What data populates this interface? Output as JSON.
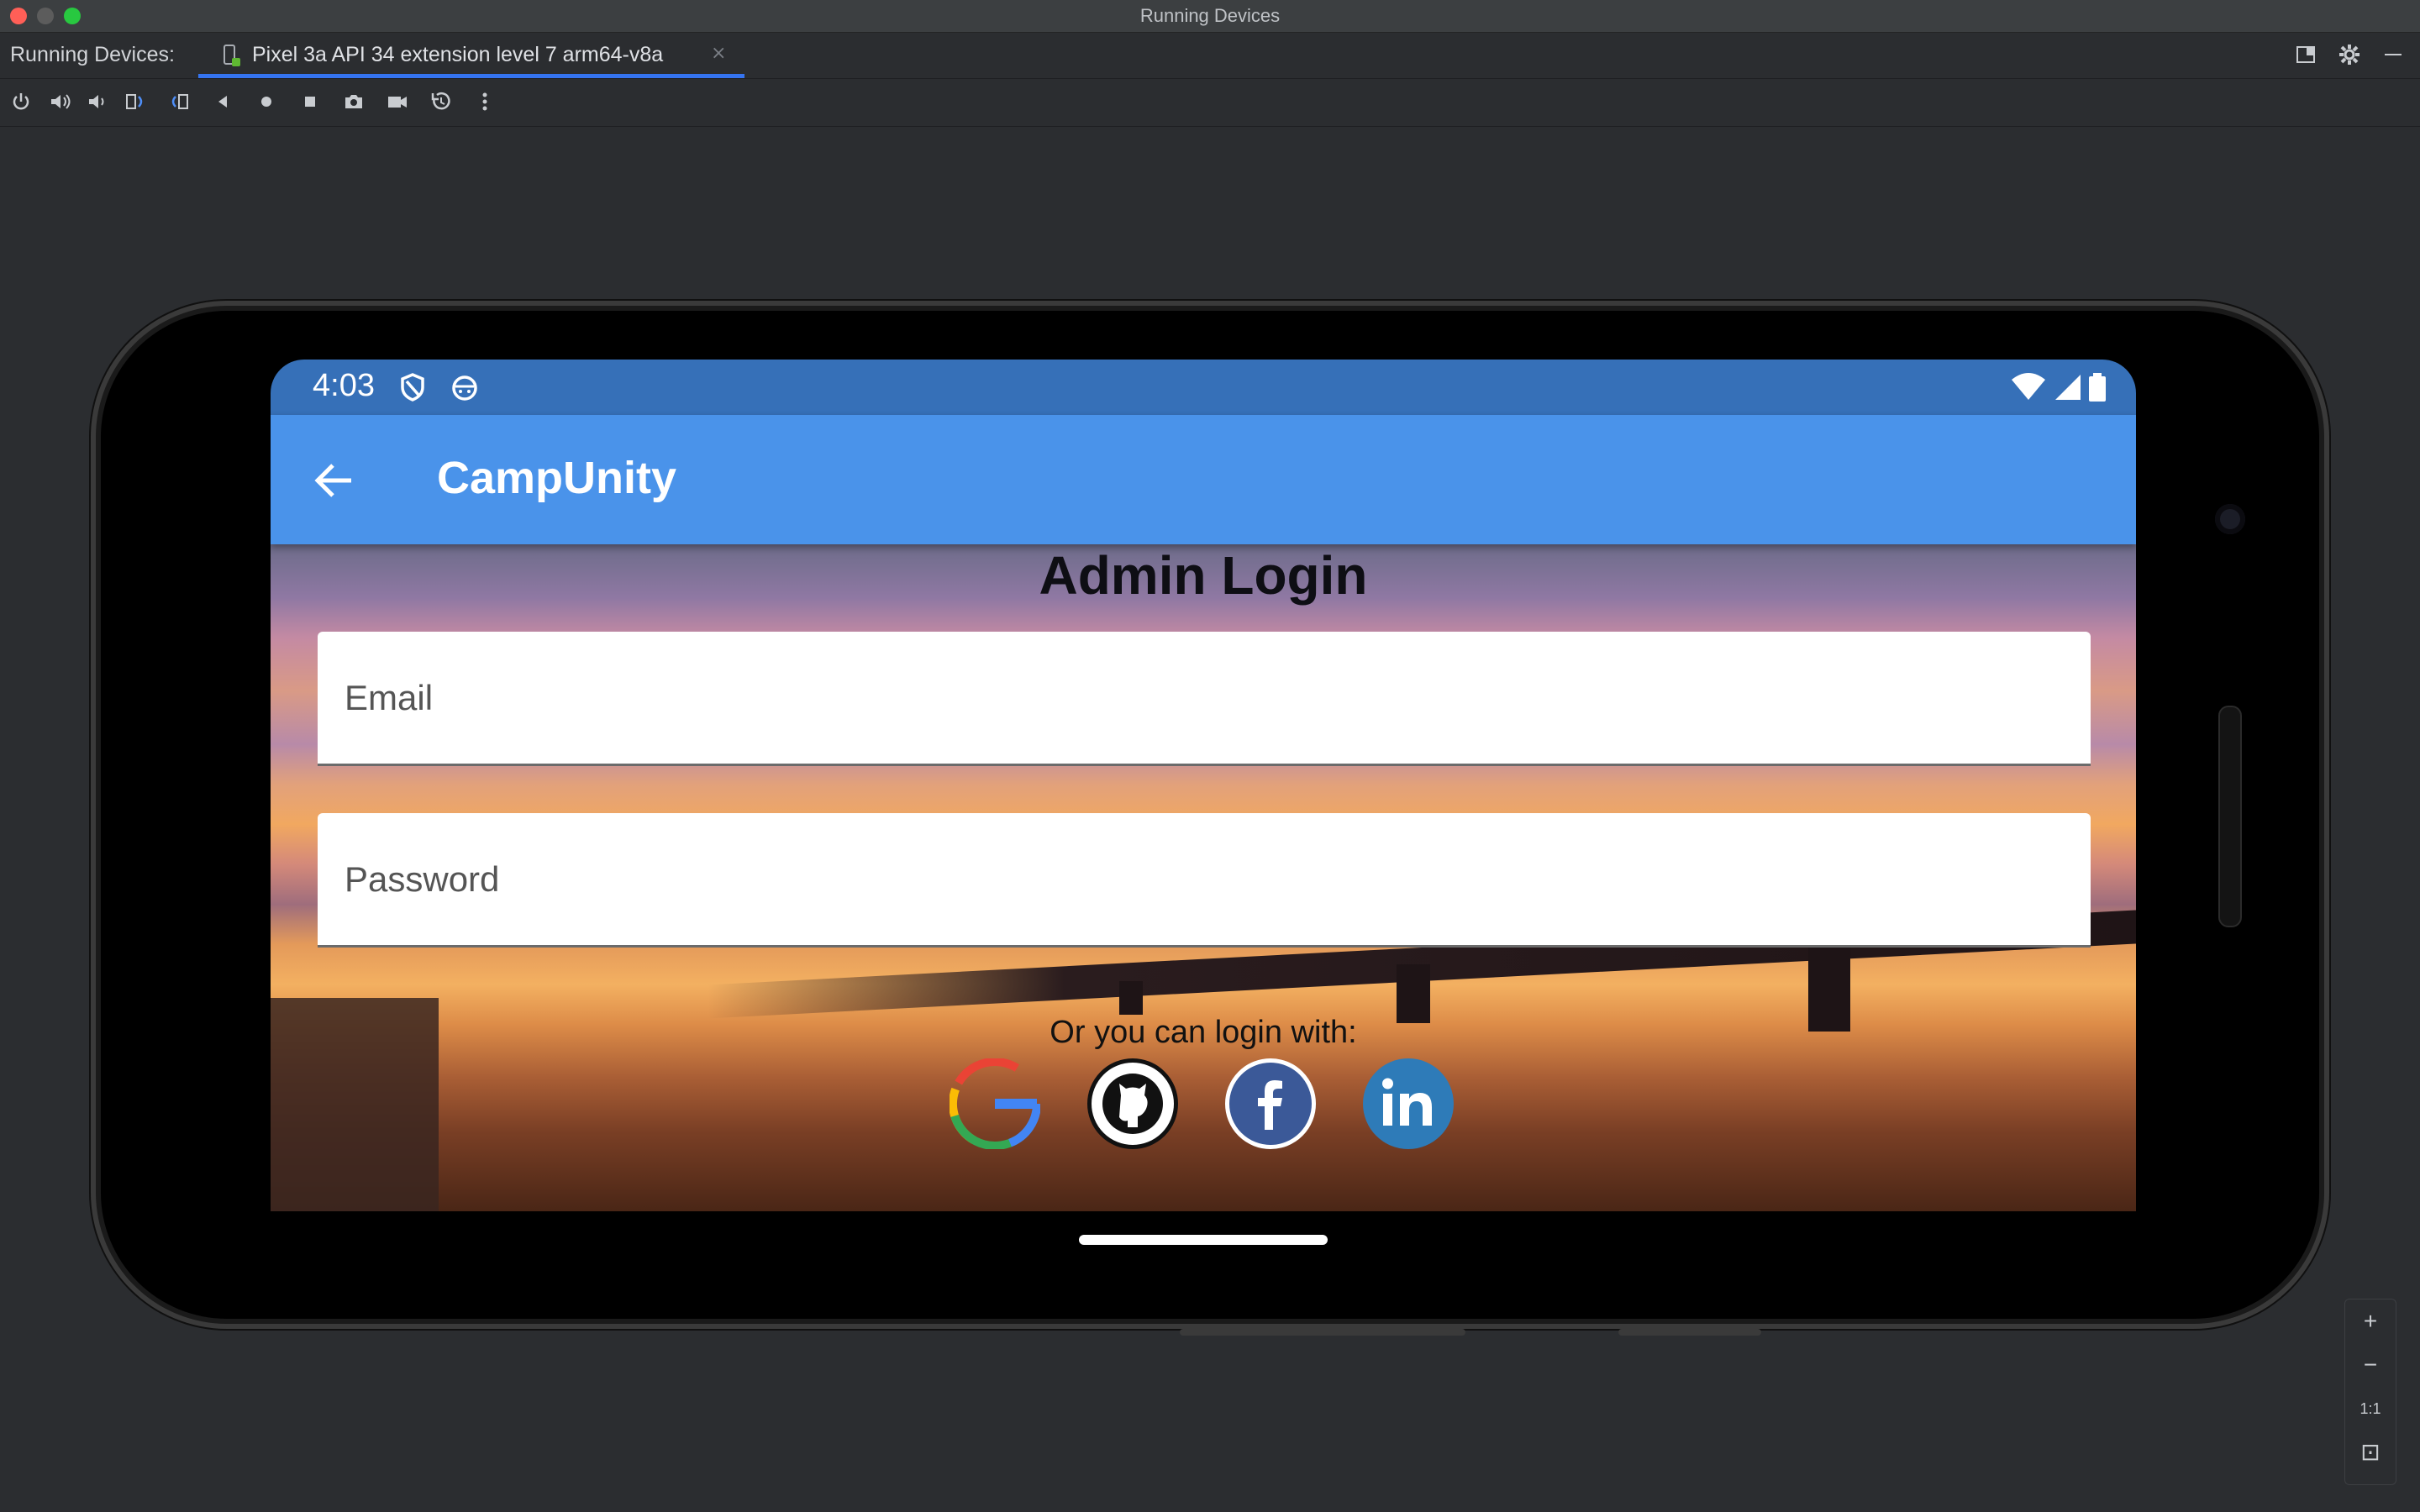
{
  "window": {
    "title": "Running Devices"
  },
  "tabbar": {
    "label": "Running Devices:",
    "device_tab": "Pixel 3a API 34 extension level 7 arm64-v8a",
    "close": "×"
  },
  "toolbar": {
    "icons": [
      "power-icon",
      "volume-up-icon",
      "volume-down-icon",
      "rotate-left-icon",
      "rotate-right-icon",
      "back-icon",
      "home-icon",
      "overview-icon",
      "screenshot-icon",
      "screen-record-icon",
      "snapshot-icon",
      "more-icon"
    ]
  },
  "device": {
    "status_time": "4:03",
    "app_title": "CampUnity",
    "screen_title": "Admin Login",
    "email_placeholder": "Email",
    "password_placeholder": "Password",
    "or_text": "Or you can login with:",
    "social": [
      "google-login-button",
      "github-login-button",
      "facebook-login-button",
      "linkedin-login-button"
    ]
  },
  "zoom": {
    "plus": "+",
    "minus": "−",
    "one_to_one": "1:1",
    "fit": "⊡"
  },
  "colors": {
    "statusbar": "#3670b8",
    "appbar": "#4a93ea",
    "tab_accent": "#3574f0"
  }
}
